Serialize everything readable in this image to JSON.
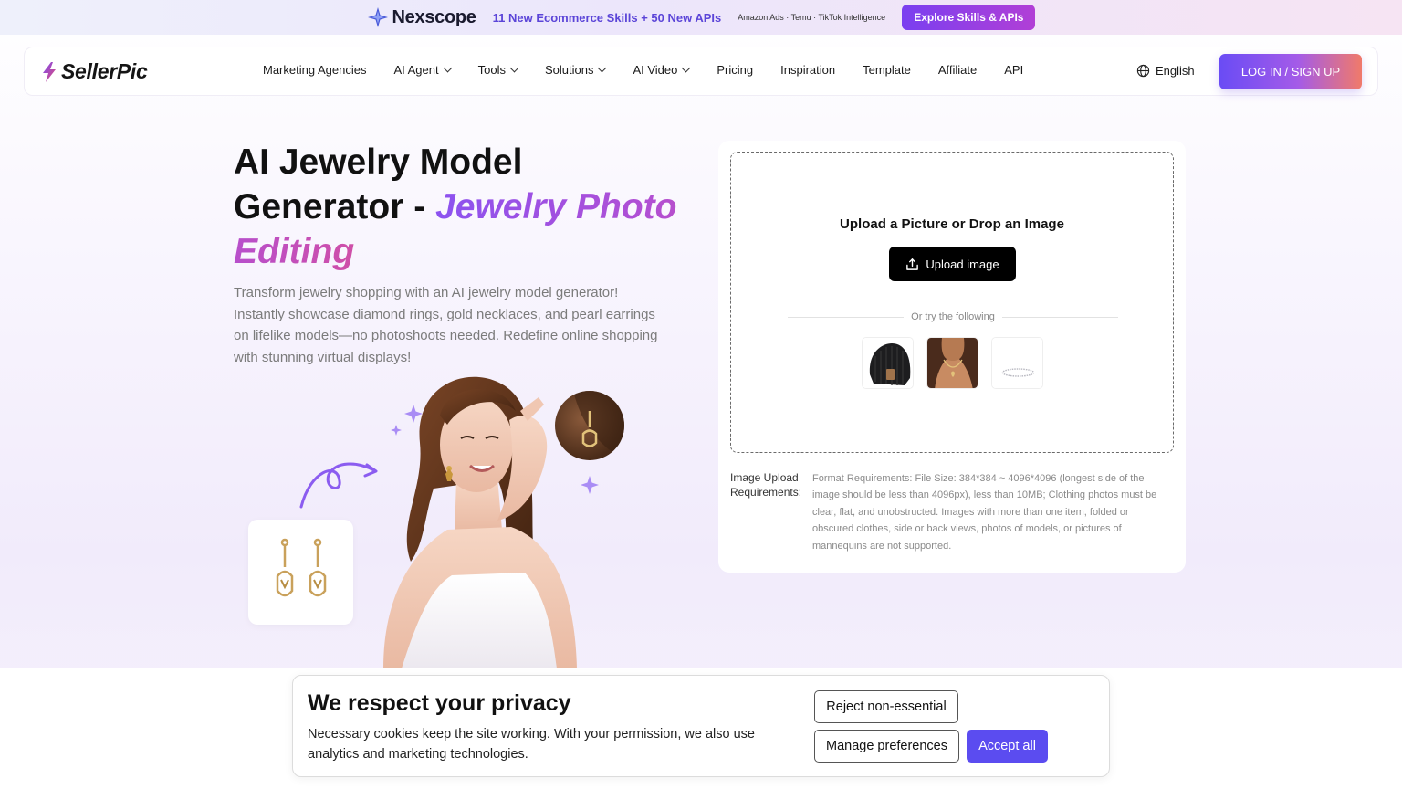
{
  "promo": {
    "brand": "Nexscope",
    "headline": "11 New Ecommerce Skills + 50 New APIs",
    "tags": "Amazon Ads · Temu · TikTok Intelligence",
    "cta": "Explore Skills & APIs"
  },
  "nav": {
    "brand": "SellerPic",
    "items": [
      {
        "label": "Marketing Agencies",
        "dropdown": false
      },
      {
        "label": "AI Agent",
        "dropdown": true
      },
      {
        "label": "Tools",
        "dropdown": true
      },
      {
        "label": "Solutions",
        "dropdown": true
      },
      {
        "label": "AI Video",
        "dropdown": true
      },
      {
        "label": "Pricing",
        "dropdown": false
      },
      {
        "label": "Inspiration",
        "dropdown": false
      },
      {
        "label": "Template",
        "dropdown": false
      },
      {
        "label": "Affiliate",
        "dropdown": false
      },
      {
        "label": "API",
        "dropdown": false
      }
    ],
    "language": "English",
    "login": "LOG IN / SIGN UP"
  },
  "hero": {
    "title_plain": "AI Jewelry Model Generator - ",
    "title_accent": "Jewelry Photo Editing",
    "description": "Transform jewelry shopping with an AI jewelry model generator! Instantly showcase diamond rings, gold necklaces, and pearl earrings on lifelike models—no photoshoots needed. Redefine online shopping with stunning virtual displays!"
  },
  "upload": {
    "title": "Upload a Picture or Drop an Image",
    "button": "Upload image",
    "try_text": "Or try the following",
    "samples": [
      "beanie-hat",
      "gold-necklace",
      "silver-bracelet"
    ],
    "req_label": "Image Upload Requirements:",
    "req_text": "Format Requirements: File Size: 384*384 ~ 4096*4096 (longest side of the image should be less than 4096px), less than 10MB; Clothing photos must be clear, flat, and unobstructed. Images with more than one item, folded or obscured clothes, side or back views, photos of models, or pictures of mannequins are not supported."
  },
  "cookie": {
    "title": "We respect your privacy",
    "text": "Necessary cookies keep the site working. With your permission, we also use analytics and marketing technologies.",
    "reject": "Reject non-essential",
    "manage": "Manage preferences",
    "accept": "Accept all"
  },
  "colors": {
    "accent": "#7a3ff0",
    "login_gradient_start": "#6a4cf5",
    "accept": "#5b4cf0"
  }
}
